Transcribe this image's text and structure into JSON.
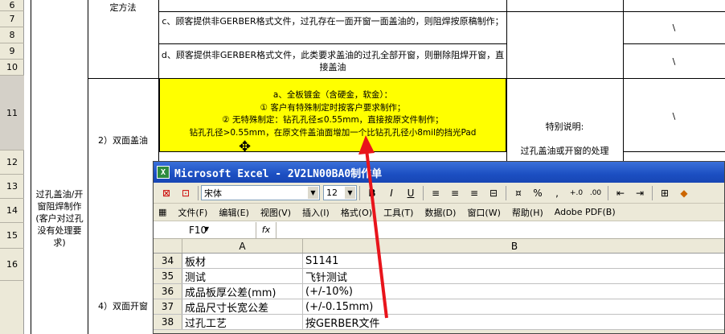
{
  "sheet": {
    "rows": [
      {
        "num": "6",
        "h": 14
      },
      {
        "num": "7",
        "h": 20
      },
      {
        "num": "8",
        "h": 20
      },
      {
        "num": "9",
        "h": 20
      },
      {
        "num": "10",
        "h": 20
      },
      {
        "num": "11",
        "h": 93
      },
      {
        "num": "12",
        "h": 30
      },
      {
        "num": "13",
        "h": 30
      },
      {
        "num": "14",
        "h": 30
      },
      {
        "num": "15",
        "h": 32
      },
      {
        "num": "16",
        "h": 40
      }
    ],
    "top_method": "定方法",
    "row_c": "c、顾客提供非GERBER格式文件，过孔存在一面开窗一面盖油的，则阻焊按原稿制作；",
    "row_d": "d、顾客提供非GERBER格式文件，此类要求盖油的过孔全部开窗，则删除阻焊开窗，直接盖油",
    "backslash": "\\",
    "double_cover": "2）双面盖油",
    "double_open": "4）双面开窗",
    "group_label": "过孔盖油/开窗阻焊制作(客户对过孔没有处理要求)",
    "yellow": {
      "line1": "a、全板镀金（含硬金，软金）：",
      "line2": "① 客户有特殊制定时按客户要求制作；",
      "line3": "② 无特殊制定：钻孔孔径≤0.55mm，直接按原文件制作；",
      "line4": "钻孔孔径>0.55mm，在原文件盖油面增加一个比钻孔孔径小8mil的挡光Pad"
    },
    "special_title": "特别说明:",
    "special_body": "过孔盖油或开窗的处理"
  },
  "excel": {
    "title": "Microsoft Excel - 2V2LN00BA0制作单",
    "font_name": "宋体",
    "font_size": "12",
    "menu": [
      "文件(F)",
      "编辑(E)",
      "视图(V)",
      "插入(I)",
      "格式(O)",
      "工具(T)",
      "数据(D)",
      "窗口(W)",
      "帮助(H)",
      "Adobe PDF(B)"
    ],
    "name_box": "F10",
    "fx": "fx",
    "columns": [
      "A",
      "B"
    ],
    "rows": [
      {
        "num": "34",
        "a": "板材",
        "b": "S1141"
      },
      {
        "num": "35",
        "a": "测试",
        "b": "飞针测试"
      },
      {
        "num": "36",
        "a": "成品板厚公差(mm)",
        "b": "(+/-10%)"
      },
      {
        "num": "37",
        "a": "成品尺寸长宽公差",
        "b": "(+/-0.15mm)"
      },
      {
        "num": "38",
        "a": "过孔工艺",
        "b": "按GERBER文件"
      }
    ]
  },
  "colors": {
    "highlight": "#ffff00",
    "arrow": "#e8141b",
    "titlebar": "#1c4fc2"
  }
}
